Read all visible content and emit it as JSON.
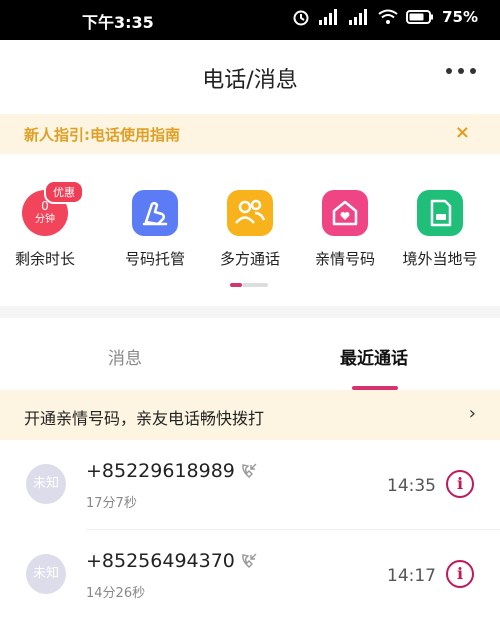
{
  "status_bar": {
    "time": "下午3:35",
    "battery": "75%"
  },
  "header": {
    "title": "电话/消息"
  },
  "guide": {
    "text": "新人指引:电话使用指南",
    "close": "×"
  },
  "features": [
    {
      "label": "剩余时长",
      "badge": "优惠",
      "value": "0",
      "unit": "分钟",
      "color": "#f2445a",
      "icon": "timer-icon"
    },
    {
      "label": "号码托管",
      "color": "#5b7cf5",
      "icon": "phone-hosting-icon"
    },
    {
      "label": "多方通话",
      "color": "#f7b21c",
      "icon": "multi-user-icon"
    },
    {
      "label": "亲情号码",
      "color": "#f04585",
      "icon": "family-home-icon"
    },
    {
      "label": "境外当地号",
      "color": "#1fbf7a",
      "icon": "sim-card-icon"
    }
  ],
  "tabs": {
    "messages": "消息",
    "recent_calls": "最近通话"
  },
  "promo": {
    "text": "开通亲情号码，亲友电话畅快拨打",
    "arrow": "›"
  },
  "calls": [
    {
      "avatar": "未知",
      "number": "+85229618989",
      "duration": "17分7秒",
      "time": "14:35"
    },
    {
      "avatar": "未知",
      "number": "+85256494370",
      "duration": "14分26秒",
      "time": "14:17"
    }
  ],
  "colors": {
    "accent": "#d6336c",
    "guide_text": "#e0a026"
  }
}
